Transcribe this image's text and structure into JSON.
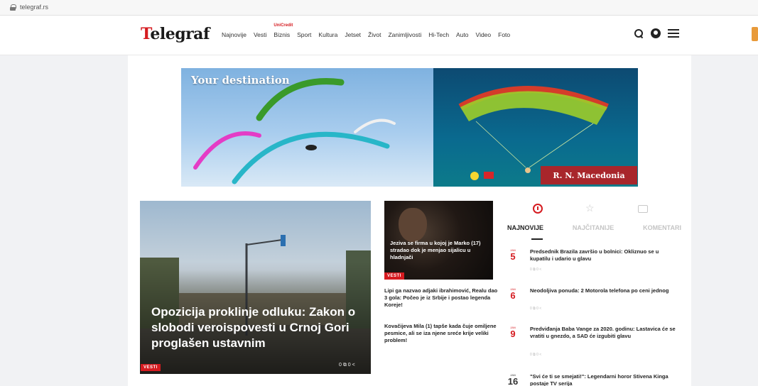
{
  "browser": {
    "url": "telegraf.rs"
  },
  "header": {
    "logo_first": "T",
    "logo_rest": "elegraf",
    "nav": [
      {
        "label": "Najnovije"
      },
      {
        "label": "Vesti"
      },
      {
        "label": "Biznis",
        "badge": "UniCredit"
      },
      {
        "label": "Sport"
      },
      {
        "label": "Kultura"
      },
      {
        "label": "Jetset"
      },
      {
        "label": "Život"
      },
      {
        "label": "Zanimljivosti"
      },
      {
        "label": "Hi-Tech"
      },
      {
        "label": "Auto"
      },
      {
        "label": "Video"
      },
      {
        "label": "Foto"
      }
    ],
    "icons": [
      "search-icon",
      "user-icon",
      "menu-icon"
    ]
  },
  "ad": {
    "slogan": "Your destination",
    "caption": "R. N. Macedonia",
    "colors": {
      "sky": "#9cc3e8",
      "panel": "#0c5a80",
      "caption_bg": "#a8262b"
    }
  },
  "lead": {
    "title": "Opozicija proklinje odluku: Zakon o slobodi veroispovesti u Crnoj Gori proglašen ustavnim",
    "tag": "VESTI",
    "tools": "0 ⧉ 0 <"
  },
  "middle": {
    "feature_caption": "Jeziva se firma u kojoj je Marko (17) stradao dok je menjao sijalicu u hladnjači",
    "feature_tag": "VESTI",
    "stories": [
      {
        "title": "Lipi ga nazvao adjaki ibrahimović, Realu dao 3 gola: Počeo je iz Srbije i postao legenda Koreje!"
      },
      {
        "title": "Kovačijeva Mila (1) tapše kada čuje omiljene pesmice, ali se iza njene sreće krije veliki problem!"
      }
    ]
  },
  "sidebar": {
    "tab_icons": [
      "clock-icon",
      "star-icon",
      "comment-icon"
    ],
    "tabs": [
      {
        "label": "NAJNOVIJE",
        "active": true
      },
      {
        "label": "NAJČITANIJE",
        "active": false
      },
      {
        "label": "KOMENTARI",
        "active": false
      }
    ],
    "items": [
      {
        "month": "JAN",
        "day": "5",
        "title": "Predsednik Brazila završio u bolnici: Okliznuo se u kupatilu i udario u glavu",
        "meta": "0 ⧉ 0 <"
      },
      {
        "month": "JAN",
        "day": "6",
        "title": "Neodoljiva ponuda: 2 Motorola telefona po ceni jednog",
        "meta": "0 ⧉ 0 <"
      },
      {
        "month": "JAN",
        "day": "9",
        "title": "Predviđanja Baba Vange za 2020. godinu: Lastavica će se vratiti u gnezdo, a SAD će izgubiti glavu",
        "meta": "0 ⧉ 0 <"
      },
      {
        "month": "JAN",
        "day": "16",
        "title": "\"Svi će ti se smejati!\": Legendarni horor Stivena Kinga postaje TV serija",
        "meta": ""
      }
    ]
  }
}
